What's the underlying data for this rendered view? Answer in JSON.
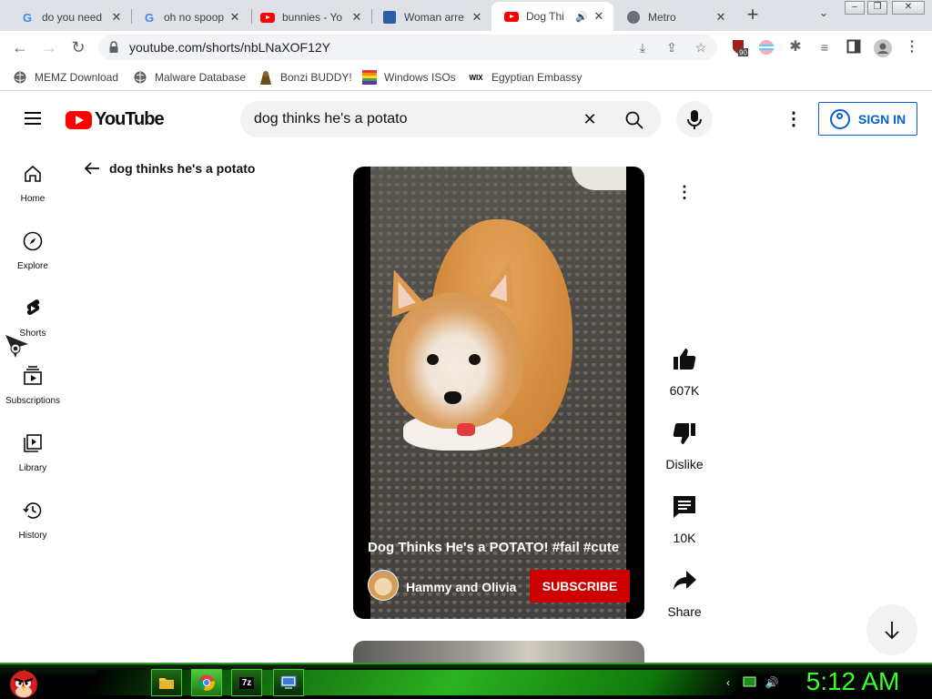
{
  "browser": {
    "tabs": [
      {
        "title": "do you need",
        "favicon": "google-icon"
      },
      {
        "title": "oh no spoop",
        "favicon": "google-icon"
      },
      {
        "title": "bunnies - Yo",
        "favicon": "youtube-icon"
      },
      {
        "title": "Woman arre",
        "favicon": "news-icon"
      },
      {
        "title": "Dog Thi",
        "favicon": "youtube-icon",
        "active": true,
        "audio": true
      },
      {
        "title": "Metro",
        "favicon": "globe-icon"
      }
    ],
    "url": "youtube.com/shorts/nbLNaXOF12Y",
    "extension_badge": "90",
    "bookmarks": [
      {
        "label": "MEMZ Download",
        "icon": "globe-icon"
      },
      {
        "label": "Malware Database",
        "icon": "globe-icon"
      },
      {
        "label": "Bonzi BUDDY!",
        "icon": "bonzi-icon"
      },
      {
        "label": "Windows ISOs",
        "icon": "windows-icon"
      },
      {
        "label": "Egyptian Embassy",
        "icon": "wix-icon"
      }
    ],
    "wix_mark": "WIX"
  },
  "youtube": {
    "logo_text": "YouTube",
    "search_query": "dog thinks he's a potato",
    "sign_in": "SIGN IN",
    "guide": [
      {
        "label": "Home",
        "icon": "home-icon"
      },
      {
        "label": "Explore",
        "icon": "explore-icon"
      },
      {
        "label": "Shorts",
        "icon": "shorts-icon"
      },
      {
        "label": "Subscriptions",
        "icon": "subscriptions-icon"
      },
      {
        "label": "Library",
        "icon": "library-icon"
      },
      {
        "label": "History",
        "icon": "history-icon"
      }
    ],
    "shorts_header": "dog thinks he's a potato",
    "video": {
      "title": "Dog Thinks He's a POTATO! #fail #cute",
      "channel": "Hammy and Olivia",
      "subscribe": "SUBSCRIBE"
    },
    "actions": {
      "likes": "607K",
      "dislike": "Dislike",
      "comments": "10K",
      "share": "Share"
    }
  },
  "taskbar": {
    "clock": "5:12 AM",
    "apps": [
      "file-explorer-icon",
      "chrome-icon",
      "7zip-icon",
      "computer-icon"
    ],
    "sevenzip_label": "7z"
  },
  "colors": {
    "youtube_red": "#ff0000",
    "subscribe_red": "#cc0000",
    "signin_blue": "#065fd4",
    "taskbar_green": "#2bb21f",
    "clock_green": "#3aff2a"
  }
}
